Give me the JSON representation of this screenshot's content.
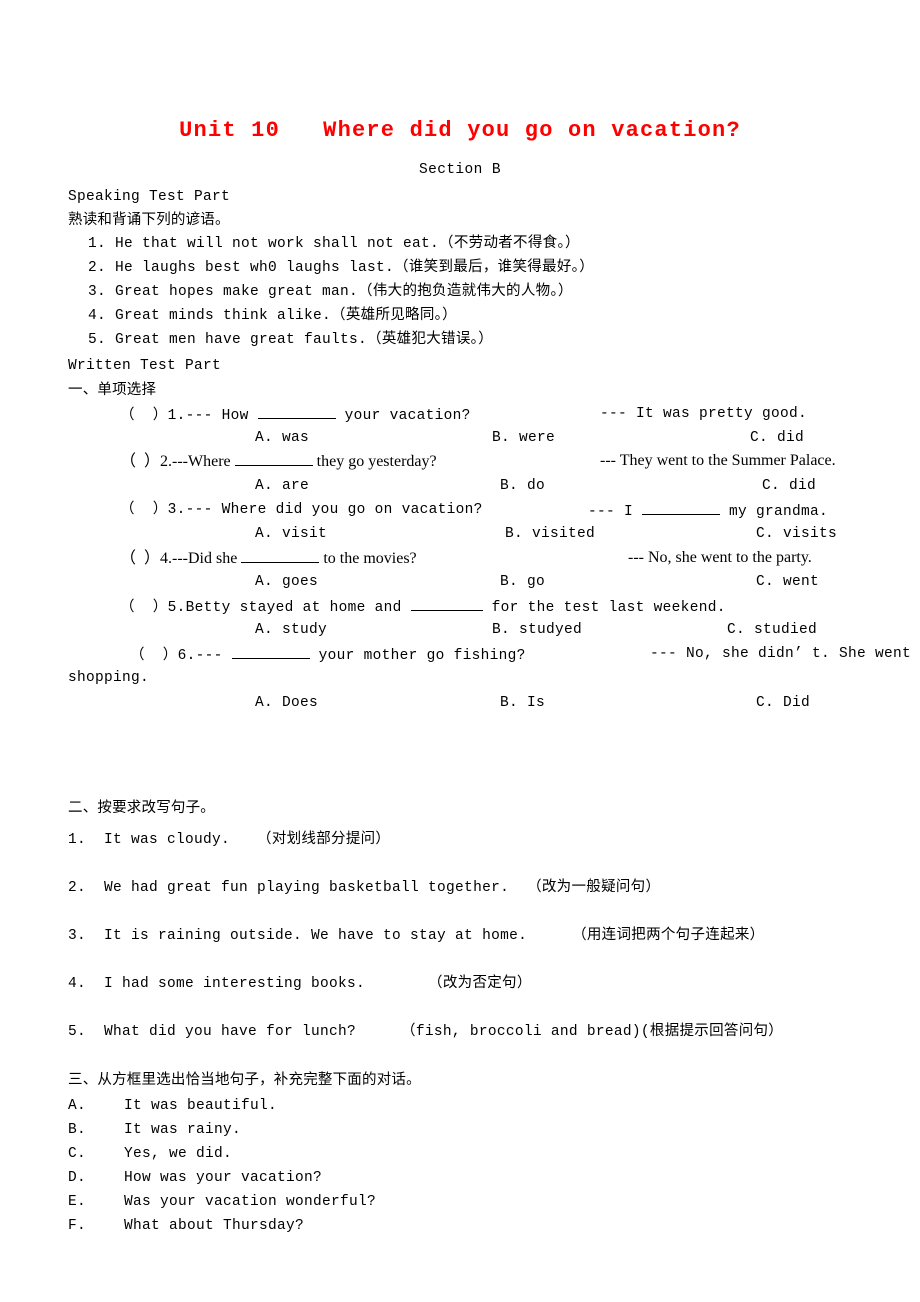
{
  "document": {
    "title": "Unit 10   Where did you go on vacation?",
    "subtitle": "Section B",
    "title_color": "#ff0000"
  },
  "speaking": {
    "heading": "Speaking Test Part",
    "instruction": "熟读和背诵下列的谚语。",
    "proverbs": [
      "1. He that will not work shall not eat.（不劳动者不得食。）",
      "2. He laughs best wh0 laughs last.（谁笑到最后，谁笑得最好。）",
      "3. Great hopes make great man.（伟大的抱负造就伟大的人物。）",
      "4. Great minds think alike.（英雄所见略同。）",
      "5. Great men have great faults.（英雄犯大错误。）"
    ]
  },
  "written": {
    "heading": "Written Test Part",
    "section_one": {
      "heading": "一、单项选择",
      "questions": [
        {
          "marker": "（  ）1.",
          "stem_before": "--- How ",
          "stem_after": " your vacation?",
          "answer": "--- It was pretty good.",
          "options": [
            "A. was",
            "B. were",
            "C. did"
          ]
        },
        {
          "marker": "（  ）2.",
          "stem_before": "---Where ",
          "stem_after": " they go yesterday?",
          "answer": "--- They went to the Summer Palace.",
          "options": [
            "A. are",
            "B. do",
            "C. did"
          ]
        },
        {
          "marker": "（  ）3.",
          "stem_before": "--- Where did you go on vacation?",
          "stem_after": "",
          "answer_before": "--- I ",
          "answer_after": " my grandma.",
          "options": [
            "A. visit",
            "B. visited",
            "C. visits"
          ]
        },
        {
          "marker": "（  ）4.",
          "stem_before": "---Did she ",
          "stem_after": " to the movies?",
          "answer": "--- No, she went to the party.",
          "options": [
            "A. goes",
            "B. go",
            "C. went"
          ]
        },
        {
          "marker": "（  ）5.",
          "stem_before": "Betty stayed at home and ",
          "stem_after": " for the test last weekend.",
          "answer": "",
          "options": [
            "A. study",
            "B. studyed",
            "C. studied"
          ]
        },
        {
          "marker": "（  ）6.",
          "stem_before": "--- ",
          "stem_after": " your mother go fishing?",
          "answer": "--- No, she didn’ t. She went",
          "answer_wrap": "shopping.",
          "options": [
            "A. Does",
            "B. Is",
            "C. Did"
          ]
        }
      ]
    },
    "section_two": {
      "heading": "二、按要求改写句子。",
      "items": [
        "1.  It was cloudy.   （对划线部分提问）",
        "2.  We had great fun playing basketball together.  （改为一般疑问句）",
        "3.  It is raining outside. We have to stay at home.     （用连词把两个句子连起来）",
        "4.  I had some interesting books.       （改为否定句）",
        "5.  What did you have for lunch?     （fish, broccoli and bread)(根据提示回答问句）"
      ]
    },
    "section_three": {
      "heading": "三、从方框里选出恰当地句子，补充完整下面的对话。",
      "choices": [
        {
          "letter": "A.",
          "text": "It was beautiful."
        },
        {
          "letter": "B.",
          "text": "It was rainy."
        },
        {
          "letter": "C.",
          "text": "Yes, we did."
        },
        {
          "letter": "D.",
          "text": "How was your vacation?"
        },
        {
          "letter": "E.",
          "text": "Was your vacation wonderful?"
        },
        {
          "letter": "F.",
          "text": "What about Thursday?"
        }
      ]
    }
  }
}
